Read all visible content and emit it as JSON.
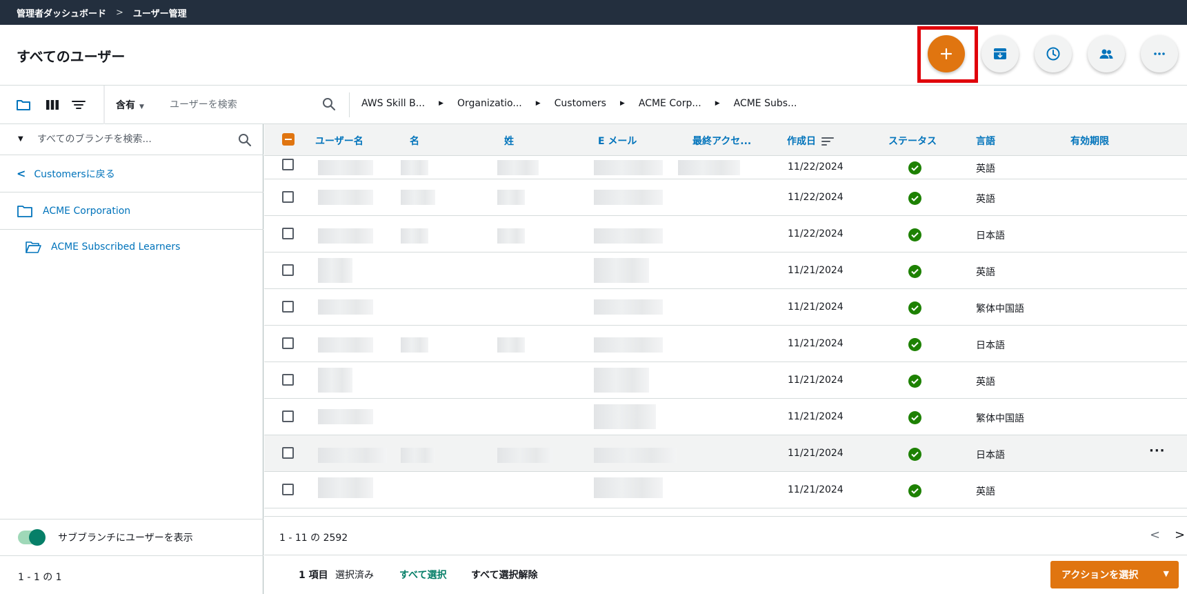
{
  "breadcrumb": {
    "root": "管理者ダッシュボード",
    "separator": ">",
    "current": "ユーザー管理"
  },
  "header": {
    "title": "すべてのユーザー",
    "buttons": [
      "add-user",
      "archive",
      "history",
      "groups",
      "more"
    ],
    "accent_color": "#e07510"
  },
  "toolbar": {
    "filter_mode": "含有",
    "search_placeholder": "ユーザーを検索",
    "path": [
      "AWS Skill B...",
      "Organizatio...",
      "Customers",
      "ACME Corp...",
      "ACME Subs..."
    ]
  },
  "sidebar": {
    "search_placeholder": "すべてのブランチを検索...",
    "back_label": "Customersに戻る",
    "org_label": "ACME Corporation",
    "sub_label": "ACME Subscribed Learners",
    "toggle_label": "サブブランチにユーザーを表示",
    "toggle_on": true,
    "count": "1 - 1 の 1"
  },
  "table": {
    "columns": [
      "ユーザー名",
      "名",
      "姓",
      "E メール",
      "最終アクセ...",
      "作成日",
      "ステータス",
      "言語",
      "有効期限"
    ],
    "sorted_column": "作成日",
    "rows": [
      {
        "created": "11/22/2024",
        "status": "active",
        "language": "英語"
      },
      {
        "created": "11/22/2024",
        "status": "active",
        "language": "英語"
      },
      {
        "created": "11/22/2024",
        "status": "active",
        "language": "日本語"
      },
      {
        "created": "11/21/2024",
        "status": "active",
        "language": "英語"
      },
      {
        "created": "11/21/2024",
        "status": "active",
        "language": "繁体中国語"
      },
      {
        "created": "11/21/2024",
        "status": "active",
        "language": "日本語"
      },
      {
        "created": "11/21/2024",
        "status": "active",
        "language": "英語"
      },
      {
        "created": "11/21/2024",
        "status": "active",
        "language": "繁体中国語"
      },
      {
        "created": "11/21/2024",
        "status": "active",
        "language": "日本語"
      },
      {
        "created": "11/21/2024",
        "status": "active",
        "language": "英語"
      }
    ]
  },
  "pagination": {
    "range": "1 - 11 の 2592"
  },
  "footer": {
    "count": "1 項目",
    "selected": "選択済み",
    "select_all": "すべて選択",
    "deselect_all": "すべて選択解除",
    "action_button": "アクションを選択"
  }
}
